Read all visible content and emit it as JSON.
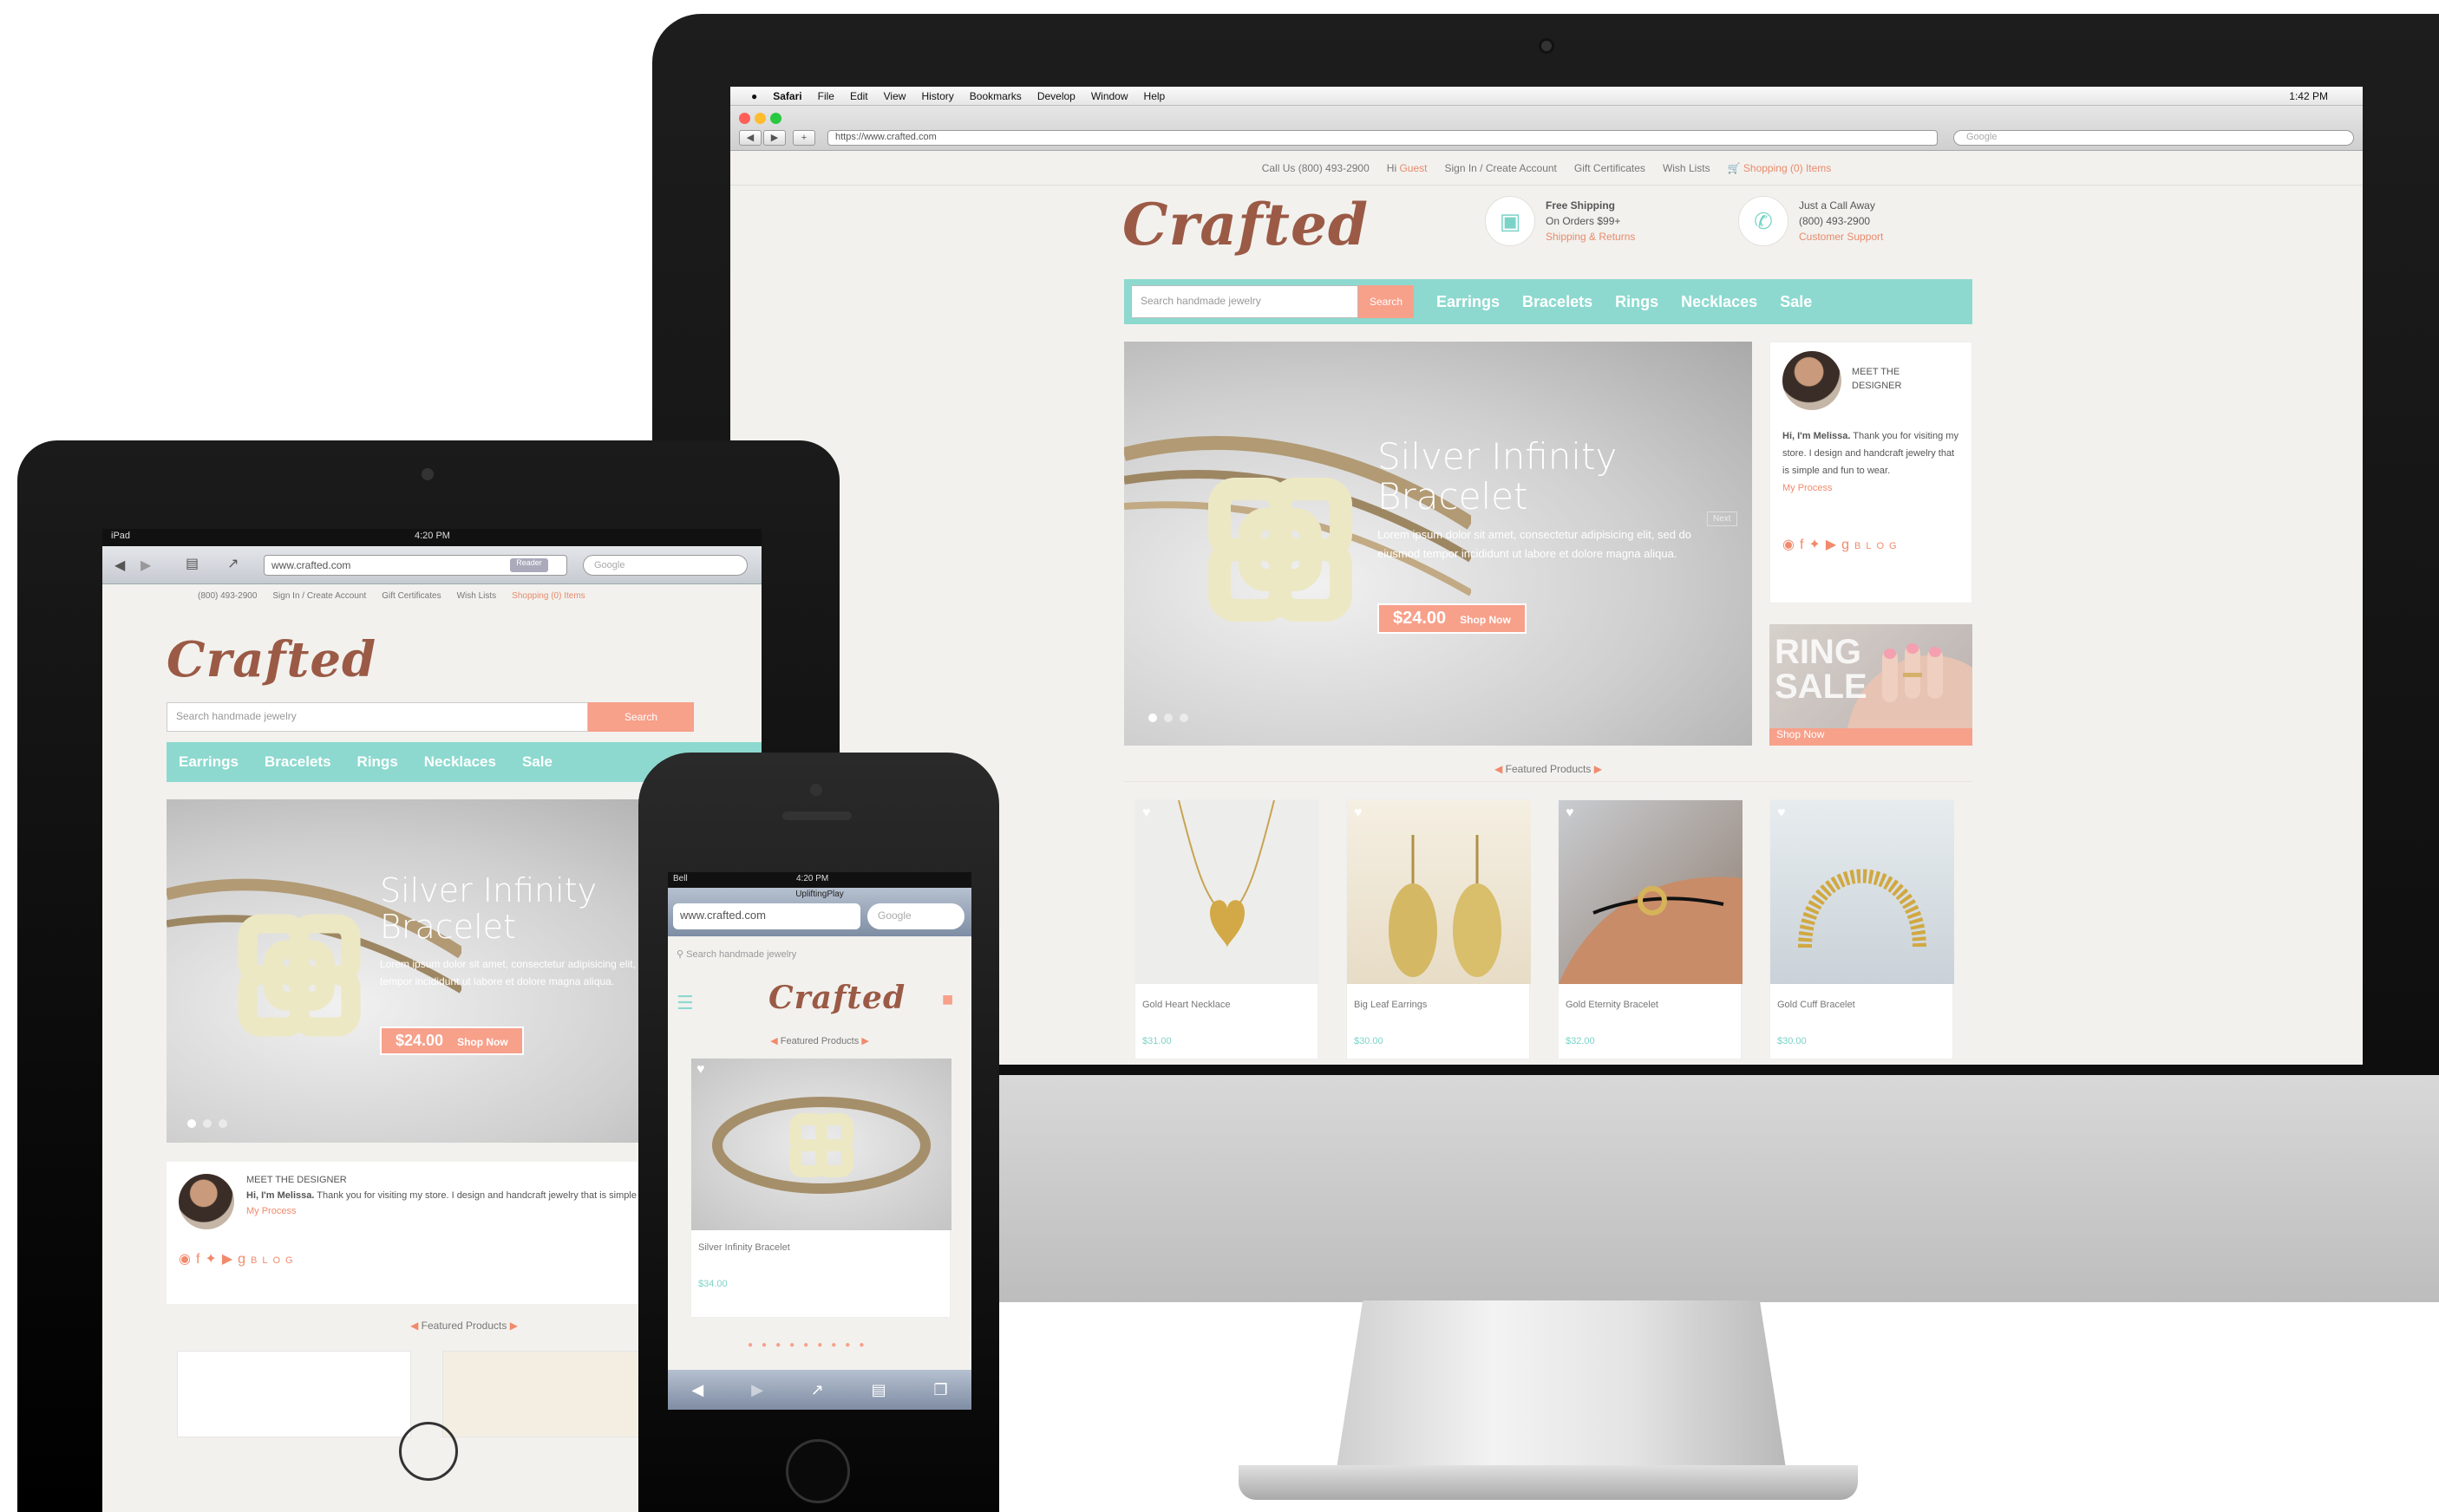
{
  "imac": {
    "menubar": {
      "apple": "",
      "items": [
        "Safari",
        "File",
        "Edit",
        "View",
        "History",
        "Bookmarks",
        "Develop",
        "Window",
        "Help"
      ],
      "clock": "1:42 PM"
    },
    "browser": {
      "url": "https://www.crafted.com",
      "search_placeholder": "Google"
    },
    "site": {
      "topstrip": {
        "phone": "Call Us (800) 493-2900",
        "greeting": "Hi",
        "guest": "Guest",
        "signin": "Sign In / Create Account",
        "gift": "Gift Certificates",
        "wish": "Wish Lists",
        "cart": "Shopping (0) Items"
      },
      "logo": "Crafted",
      "shipping": {
        "line1": "Free Shipping",
        "line2": "On Orders $99+",
        "sub": "Shipping & Returns"
      },
      "call": {
        "line1": "Just a Call Away",
        "line2": "(800) 493-2900",
        "sub": "Customer Support"
      },
      "search_placeholder": "Search handmade jewelry",
      "search_button": "Search",
      "nav": [
        "Earrings",
        "Bracelets",
        "Rings",
        "Necklaces",
        "Sale"
      ],
      "hero": {
        "title1": "Silver Infinity",
        "title2": "Bracelet",
        "body": "Lorem ipsum dolor sit amet, consectetur adipisicing elit, sed do eiusmod tempor incididunt ut labore et dolore magna aliqua.",
        "price": "$24.00",
        "cta": "Shop Now",
        "next": "Next"
      },
      "designer": {
        "label1": "MEET THE",
        "label2": "DESIGNER",
        "intro": "Hi, I'm Melissa.",
        "body": "Thank you for visiting my store. I design and handcraft jewelry that is simple and fun to wear.",
        "link": "My Process",
        "blog": "BLOG"
      },
      "promo": {
        "title1": "RING",
        "title2": "SALE",
        "cta": "Shop Now"
      },
      "featured_title": "Featured Products",
      "products": [
        {
          "name": "Gold Heart Necklace",
          "price": "$31.00"
        },
        {
          "name": "Big Leaf Earrings",
          "price": "$30.00"
        },
        {
          "name": "Gold Eternity Bracelet",
          "price": "$32.00"
        },
        {
          "name": "Gold Cuff Bracelet",
          "price": "$30.00"
        }
      ]
    }
  },
  "ipad": {
    "status": "iPad",
    "time": "4:20 PM",
    "url": "www.crafted.com",
    "reader": "Reader",
    "search": "Google",
    "topstrip": {
      "phone": "(800) 493-2900",
      "signin": "Sign In / Create Account",
      "gift": "Gift Certificates",
      "wish": "Wish Lists",
      "cart": "Shopping (0) Items"
    },
    "logo": "Crafted",
    "search_placeholder": "Search handmade jewelry",
    "search_button": "Search",
    "nav": [
      "Earrings",
      "Bracelets",
      "Rings",
      "Necklaces",
      "Sale"
    ],
    "hero": {
      "title1": "Silver Infinity",
      "title2": "Bracelet",
      "body": "Lorem ipsum dolor sit amet, consectetur adipisicing elit, sed do eiusmod tempor incididunt ut labore et dolore magna aliqua.",
      "price": "$24.00",
      "cta": "Shop Now"
    },
    "designer": {
      "label": "MEET THE DESIGNER",
      "intro": "Hi, I'm Melissa.",
      "body": "Thank you for visiting my store. I design and handcraft jewelry that is simple and fun to wear.",
      "link": "My Process",
      "blog": "BLOG"
    },
    "featured_title": "Featured Products"
  },
  "iphone": {
    "carrier": "Bell",
    "time": "4:20 PM",
    "title": "UpliftingPlay",
    "url": "www.crafted.com",
    "search": "Google",
    "search_placeholder": "Search handmade jewelry",
    "logo": "Crafted",
    "featured_title": "Featured Products",
    "product": {
      "name": "Silver Infinity Bracelet",
      "price": "$34.00"
    }
  },
  "colors": {
    "teal": "#8dd9cf",
    "coral": "#f7a08a",
    "logo": "#9b5a45",
    "bg": "#f2f1ee"
  }
}
